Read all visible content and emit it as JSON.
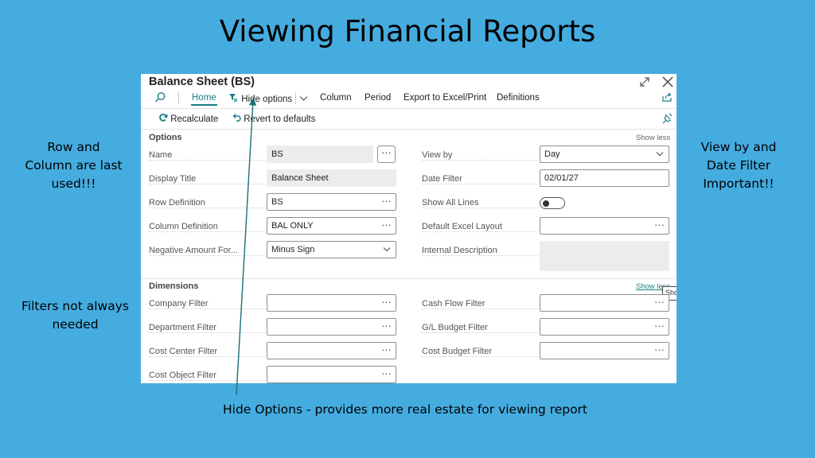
{
  "slide": {
    "title": "Viewing Financial Reports",
    "note_left_1": "Row and Column are last used!!!",
    "note_left_2": "Filters not always needed",
    "note_right": "View by and Date Filter Important!!",
    "caption": "Hide Options - provides more real estate for viewing report"
  },
  "window": {
    "title": "Balance Sheet (BS)"
  },
  "menu": {
    "home": "Home",
    "hide_options": "Hide options",
    "column": "Column",
    "period": "Period",
    "export": "Export to Excel/Print",
    "definitions": "Definitions"
  },
  "actions": {
    "recalculate": "Recalculate",
    "revert": "Revert to defaults"
  },
  "options": {
    "title": "Options",
    "show_less": "Show less",
    "left": [
      {
        "label": "Name",
        "value": "BS"
      },
      {
        "label": "Display Title",
        "value": "Balance Sheet"
      },
      {
        "label": "Row Definition",
        "value": "BS"
      },
      {
        "label": "Column Definition",
        "value": "BAL ONLY"
      },
      {
        "label": "Negative Amount For...",
        "value": "Minus Sign"
      }
    ],
    "right": [
      {
        "label": "View by",
        "value": "Day"
      },
      {
        "label": "Date Filter",
        "value": "02/01/27"
      },
      {
        "label": "Show All Lines",
        "value": ""
      },
      {
        "label": "Default Excel Layout",
        "value": ""
      },
      {
        "label": "Internal Description",
        "value": ""
      }
    ]
  },
  "dimensions": {
    "title": "Dimensions",
    "show_less": "Show less",
    "tooltip_fragment": "Sho",
    "left": [
      {
        "label": "Company Filter",
        "value": ""
      },
      {
        "label": "Department Filter",
        "value": ""
      },
      {
        "label": "Cost Center Filter",
        "value": ""
      },
      {
        "label": "Cost Object Filter",
        "value": ""
      }
    ],
    "right": [
      {
        "label": "Cash Flow Filter",
        "value": ""
      },
      {
        "label": "G/L Budget Filter",
        "value": ""
      },
      {
        "label": "Cost Budget Filter",
        "value": ""
      }
    ]
  },
  "glyphs": {
    "ellipsis": "···"
  },
  "colors": {
    "background": "#45ACE0",
    "accent": "#1a7f86",
    "arrow": "#1a6f78"
  }
}
